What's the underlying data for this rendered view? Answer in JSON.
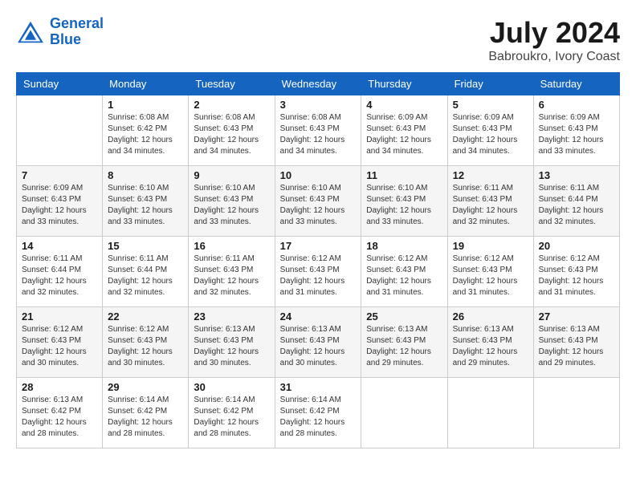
{
  "header": {
    "logo_line1": "General",
    "logo_line2": "Blue",
    "month_year": "July 2024",
    "location": "Babroukro, Ivory Coast"
  },
  "days_of_week": [
    "Sunday",
    "Monday",
    "Tuesday",
    "Wednesday",
    "Thursday",
    "Friday",
    "Saturday"
  ],
  "weeks": [
    [
      {
        "day": "",
        "sunrise": "",
        "sunset": "",
        "daylight": ""
      },
      {
        "day": "1",
        "sunrise": "Sunrise: 6:08 AM",
        "sunset": "Sunset: 6:42 PM",
        "daylight": "Daylight: 12 hours and 34 minutes."
      },
      {
        "day": "2",
        "sunrise": "Sunrise: 6:08 AM",
        "sunset": "Sunset: 6:43 PM",
        "daylight": "Daylight: 12 hours and 34 minutes."
      },
      {
        "day": "3",
        "sunrise": "Sunrise: 6:08 AM",
        "sunset": "Sunset: 6:43 PM",
        "daylight": "Daylight: 12 hours and 34 minutes."
      },
      {
        "day": "4",
        "sunrise": "Sunrise: 6:09 AM",
        "sunset": "Sunset: 6:43 PM",
        "daylight": "Daylight: 12 hours and 34 minutes."
      },
      {
        "day": "5",
        "sunrise": "Sunrise: 6:09 AM",
        "sunset": "Sunset: 6:43 PM",
        "daylight": "Daylight: 12 hours and 34 minutes."
      },
      {
        "day": "6",
        "sunrise": "Sunrise: 6:09 AM",
        "sunset": "Sunset: 6:43 PM",
        "daylight": "Daylight: 12 hours and 33 minutes."
      }
    ],
    [
      {
        "day": "7",
        "sunrise": "Sunrise: 6:09 AM",
        "sunset": "Sunset: 6:43 PM",
        "daylight": "Daylight: 12 hours and 33 minutes."
      },
      {
        "day": "8",
        "sunrise": "Sunrise: 6:10 AM",
        "sunset": "Sunset: 6:43 PM",
        "daylight": "Daylight: 12 hours and 33 minutes."
      },
      {
        "day": "9",
        "sunrise": "Sunrise: 6:10 AM",
        "sunset": "Sunset: 6:43 PM",
        "daylight": "Daylight: 12 hours and 33 minutes."
      },
      {
        "day": "10",
        "sunrise": "Sunrise: 6:10 AM",
        "sunset": "Sunset: 6:43 PM",
        "daylight": "Daylight: 12 hours and 33 minutes."
      },
      {
        "day": "11",
        "sunrise": "Sunrise: 6:10 AM",
        "sunset": "Sunset: 6:43 PM",
        "daylight": "Daylight: 12 hours and 33 minutes."
      },
      {
        "day": "12",
        "sunrise": "Sunrise: 6:11 AM",
        "sunset": "Sunset: 6:43 PM",
        "daylight": "Daylight: 12 hours and 32 minutes."
      },
      {
        "day": "13",
        "sunrise": "Sunrise: 6:11 AM",
        "sunset": "Sunset: 6:44 PM",
        "daylight": "Daylight: 12 hours and 32 minutes."
      }
    ],
    [
      {
        "day": "14",
        "sunrise": "Sunrise: 6:11 AM",
        "sunset": "Sunset: 6:44 PM",
        "daylight": "Daylight: 12 hours and 32 minutes."
      },
      {
        "day": "15",
        "sunrise": "Sunrise: 6:11 AM",
        "sunset": "Sunset: 6:44 PM",
        "daylight": "Daylight: 12 hours and 32 minutes."
      },
      {
        "day": "16",
        "sunrise": "Sunrise: 6:11 AM",
        "sunset": "Sunset: 6:43 PM",
        "daylight": "Daylight: 12 hours and 32 minutes."
      },
      {
        "day": "17",
        "sunrise": "Sunrise: 6:12 AM",
        "sunset": "Sunset: 6:43 PM",
        "daylight": "Daylight: 12 hours and 31 minutes."
      },
      {
        "day": "18",
        "sunrise": "Sunrise: 6:12 AM",
        "sunset": "Sunset: 6:43 PM",
        "daylight": "Daylight: 12 hours and 31 minutes."
      },
      {
        "day": "19",
        "sunrise": "Sunrise: 6:12 AM",
        "sunset": "Sunset: 6:43 PM",
        "daylight": "Daylight: 12 hours and 31 minutes."
      },
      {
        "day": "20",
        "sunrise": "Sunrise: 6:12 AM",
        "sunset": "Sunset: 6:43 PM",
        "daylight": "Daylight: 12 hours and 31 minutes."
      }
    ],
    [
      {
        "day": "21",
        "sunrise": "Sunrise: 6:12 AM",
        "sunset": "Sunset: 6:43 PM",
        "daylight": "Daylight: 12 hours and 30 minutes."
      },
      {
        "day": "22",
        "sunrise": "Sunrise: 6:12 AM",
        "sunset": "Sunset: 6:43 PM",
        "daylight": "Daylight: 12 hours and 30 minutes."
      },
      {
        "day": "23",
        "sunrise": "Sunrise: 6:13 AM",
        "sunset": "Sunset: 6:43 PM",
        "daylight": "Daylight: 12 hours and 30 minutes."
      },
      {
        "day": "24",
        "sunrise": "Sunrise: 6:13 AM",
        "sunset": "Sunset: 6:43 PM",
        "daylight": "Daylight: 12 hours and 30 minutes."
      },
      {
        "day": "25",
        "sunrise": "Sunrise: 6:13 AM",
        "sunset": "Sunset: 6:43 PM",
        "daylight": "Daylight: 12 hours and 29 minutes."
      },
      {
        "day": "26",
        "sunrise": "Sunrise: 6:13 AM",
        "sunset": "Sunset: 6:43 PM",
        "daylight": "Daylight: 12 hours and 29 minutes."
      },
      {
        "day": "27",
        "sunrise": "Sunrise: 6:13 AM",
        "sunset": "Sunset: 6:43 PM",
        "daylight": "Daylight: 12 hours and 29 minutes."
      }
    ],
    [
      {
        "day": "28",
        "sunrise": "Sunrise: 6:13 AM",
        "sunset": "Sunset: 6:42 PM",
        "daylight": "Daylight: 12 hours and 28 minutes."
      },
      {
        "day": "29",
        "sunrise": "Sunrise: 6:14 AM",
        "sunset": "Sunset: 6:42 PM",
        "daylight": "Daylight: 12 hours and 28 minutes."
      },
      {
        "day": "30",
        "sunrise": "Sunrise: 6:14 AM",
        "sunset": "Sunset: 6:42 PM",
        "daylight": "Daylight: 12 hours and 28 minutes."
      },
      {
        "day": "31",
        "sunrise": "Sunrise: 6:14 AM",
        "sunset": "Sunset: 6:42 PM",
        "daylight": "Daylight: 12 hours and 28 minutes."
      },
      {
        "day": "",
        "sunrise": "",
        "sunset": "",
        "daylight": ""
      },
      {
        "day": "",
        "sunrise": "",
        "sunset": "",
        "daylight": ""
      },
      {
        "day": "",
        "sunrise": "",
        "sunset": "",
        "daylight": ""
      }
    ]
  ]
}
